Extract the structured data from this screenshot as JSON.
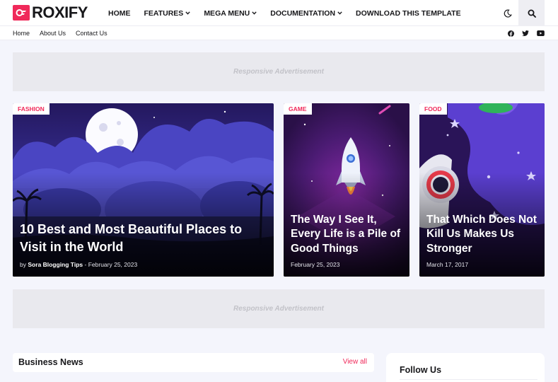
{
  "brand": {
    "name": "ROXIFY",
    "accent": "#f0295a"
  },
  "nav": {
    "items": [
      {
        "label": "HOME",
        "dropdown": false
      },
      {
        "label": "FEATURES",
        "dropdown": true
      },
      {
        "label": "MEGA MENU",
        "dropdown": true
      },
      {
        "label": "DOCUMENTATION",
        "dropdown": true
      },
      {
        "label": "DOWNLOAD THIS TEMPLATE",
        "dropdown": false
      }
    ],
    "dark_mode_icon": "moon-icon",
    "search_icon": "search-icon"
  },
  "subnav": {
    "links": [
      "Home",
      "About Us",
      "Contact Us"
    ],
    "socials": [
      "facebook-icon",
      "twitter-icon",
      "youtube-icon"
    ]
  },
  "ads": {
    "label": "Responsive Advertisement"
  },
  "featured": [
    {
      "category": "FASHION",
      "title": "10 Best and Most Beautiful Places to Visit in the World",
      "by": "by",
      "author": "Sora Blogging Tips",
      "separator": "-",
      "date": "February 25, 2023"
    },
    {
      "category": "GAME",
      "title": "The Way I See It, Every Life is a Pile of Good Things",
      "date": "February 25, 2023"
    },
    {
      "category": "FOOD",
      "title": "That Which Does Not Kill Us Makes Us Stronger",
      "date": "March 17, 2017"
    }
  ],
  "business_news": {
    "title": "Business News",
    "view_all": "View all"
  },
  "follow_us": {
    "title": "Follow Us"
  }
}
